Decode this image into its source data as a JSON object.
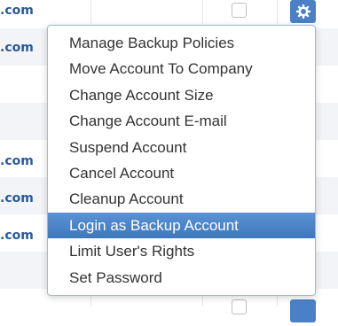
{
  "table": {
    "email_fragments": [
      ".com",
      ".com",
      "",
      "",
      ".com",
      ".com",
      ".com",
      ""
    ],
    "action_icon": "gear-icon",
    "colors": {
      "link": "#2a5a9b",
      "gear_button": "#4a80c6",
      "stripe": "#f2f4f7"
    }
  },
  "menu": {
    "items": [
      {
        "label": "Manage Backup Policies"
      },
      {
        "label": "Move Account To Company"
      },
      {
        "label": "Change Account Size"
      },
      {
        "label": "Change Account E-mail"
      },
      {
        "label": "Suspend Account"
      },
      {
        "label": "Cancel Account"
      },
      {
        "label": "Cleanup Account"
      },
      {
        "label": "Login as Backup Account"
      },
      {
        "label": "Limit User's Rights"
      },
      {
        "label": "Set Password"
      }
    ],
    "active_item": "Login as Backup Account",
    "colors": {
      "active_bg": "#4a84c8",
      "active_text": "#ffffff",
      "text": "#333333"
    }
  }
}
